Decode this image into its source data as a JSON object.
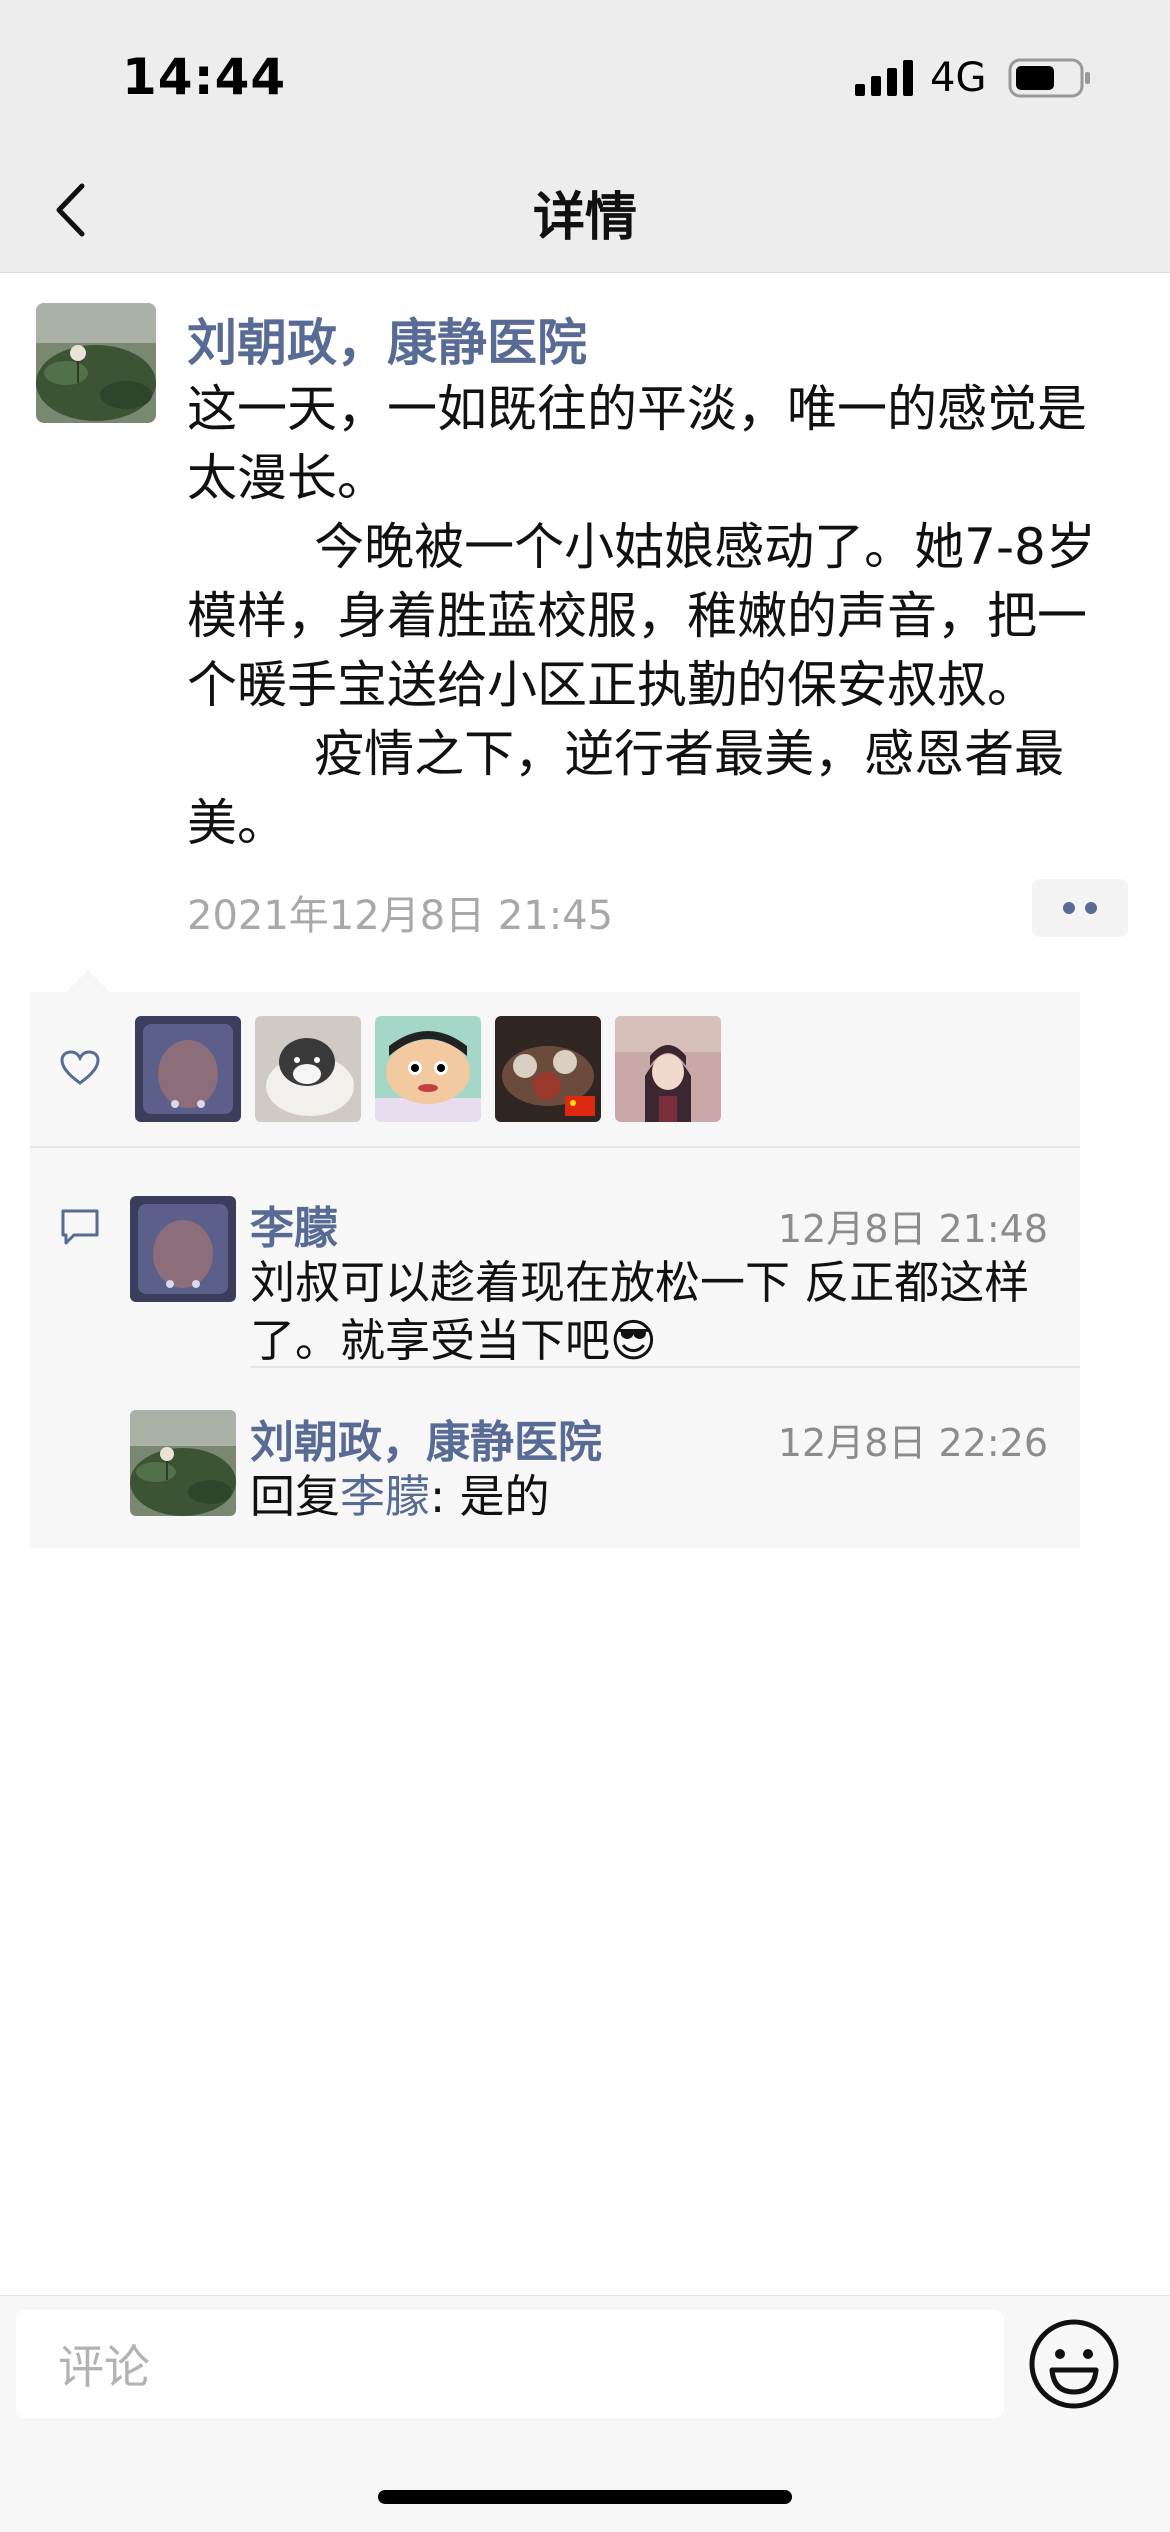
{
  "status_bar": {
    "time": "14:44",
    "network": "4G",
    "icons": [
      "signal-icon",
      "battery-icon"
    ]
  },
  "nav": {
    "title": "详情",
    "back_icon": "chevron-left-icon"
  },
  "post": {
    "author": "刘朝政，康静医院",
    "paragraphs": [
      "这一天，一如既往的平淡，唯一的感觉是太漫长。",
      "        今晚被一个小姑娘感动了。她7-8岁模样，身着胜蓝校服，稚嫩的声音，把一个暖手宝送给小区正执勤的保安叔叔。",
      "        疫情之下，逆行者最美，感恩者最美。"
    ],
    "time": "2021年12月8日 21:45",
    "more_icon": "more-dots-icon"
  },
  "likes": {
    "icon": "heart-icon",
    "count_shown": 5
  },
  "comments": [
    {
      "name": "李朦",
      "time": "12月8日 21:48",
      "text": "刘叔可以趁着现在放松一下 反正都这样了。就享受当下吧😎"
    },
    {
      "name": "刘朝政，康静医院",
      "time": "12月8日 22:26",
      "reply_prefix": "回复",
      "reply_to": "李朦",
      "reply_text": ": 是的"
    }
  ],
  "input": {
    "placeholder": "评论",
    "emoji_icon": "smiley-face-icon"
  },
  "colors": {
    "link": "#576b95",
    "nav_bg": "#ededed",
    "panel_bg": "#f7f7f7"
  }
}
